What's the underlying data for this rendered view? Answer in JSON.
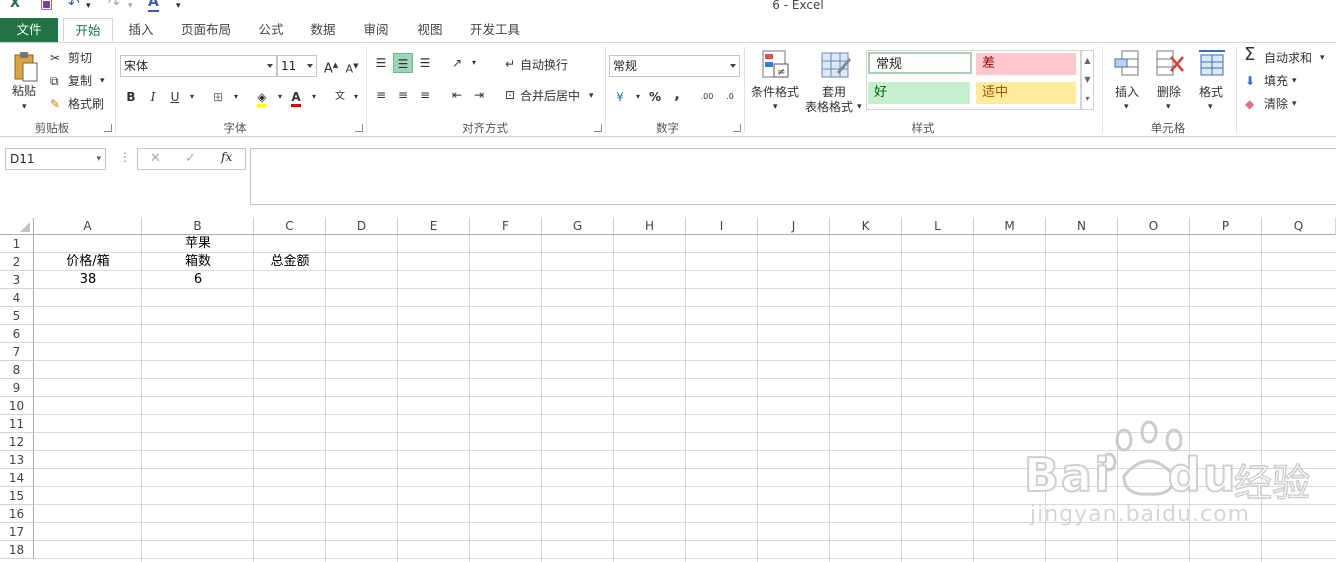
{
  "window": {
    "title": "6 - Excel"
  },
  "tabs": [
    "文件",
    "开始",
    "插入",
    "页面布局",
    "公式",
    "数据",
    "审阅",
    "视图",
    "开发工具"
  ],
  "ribbon": {
    "clipboard": {
      "paste": "粘贴",
      "cut": "剪切",
      "copy": "复制",
      "format_painter": "格式刷",
      "label": "剪贴板"
    },
    "font": {
      "name": "宋体",
      "size": "11",
      "bold": "B",
      "italic": "I",
      "underline": "U",
      "label": "字体"
    },
    "alignment": {
      "wrap_text": "自动换行",
      "merge_center": "合并后居中",
      "label": "对齐方式"
    },
    "number": {
      "format": "常规",
      "percent": "%",
      "comma": ",",
      "label": "数字"
    },
    "styles": {
      "conditional": "条件格式",
      "table_format_1": "套用",
      "table_format_2": "表格格式",
      "normal": "常规",
      "bad": "差",
      "good": "好",
      "neutral": "适中",
      "label": "样式"
    },
    "cells": {
      "insert": "插入",
      "delete": "删除",
      "format": "格式",
      "label": "单元格"
    },
    "editing": {
      "autosum": "自动求和",
      "fill": "填充",
      "clear": "清除"
    }
  },
  "formula_bar": {
    "name_box": "D11",
    "fx": "fx",
    "value": ""
  },
  "columns": [
    "A",
    "B",
    "C",
    "D",
    "E",
    "F",
    "G",
    "H",
    "I",
    "J",
    "K",
    "L",
    "M",
    "N",
    "O",
    "P",
    "Q"
  ],
  "rows": [
    "1",
    "2",
    "3",
    "4",
    "5",
    "6",
    "7",
    "8",
    "9",
    "10",
    "11",
    "12",
    "13",
    "14",
    "15",
    "16",
    "17",
    "18"
  ],
  "cells": {
    "b1": "苹果",
    "a2": "价格/箱",
    "b2": "箱数",
    "c2": "总金额",
    "a3": "38",
    "b3": "6"
  },
  "watermark": {
    "brand": "Bai",
    "brand2": "du",
    "cn": "经验",
    "url": "jingyan.baidu.com"
  },
  "colors": {
    "excel_green": "#217346",
    "bad_bg": "#ffc7ce",
    "bad_fg": "#9c0006",
    "good_bg": "#c6efce",
    "good_fg": "#006100",
    "neutral_bg": "#ffeb9c",
    "neutral_fg": "#9c5700"
  }
}
